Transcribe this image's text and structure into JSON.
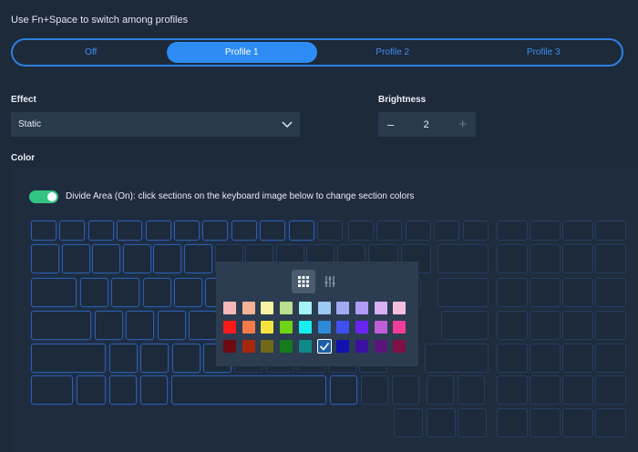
{
  "hint": "Use Fn+Space to switch among profiles",
  "profiles": {
    "tabs": [
      "Off",
      "Profile 1",
      "Profile 2",
      "Profile 3"
    ],
    "active": "Profile 1"
  },
  "effect": {
    "label": "Effect",
    "value": "Static",
    "icon": "chevron-down-icon"
  },
  "brightness": {
    "label": "Brightness",
    "value": "2",
    "minus": "–",
    "plus": "+"
  },
  "color": {
    "label": "Color",
    "divide_area": {
      "enabled": true,
      "label": "Divide Area (On): click sections on the keyboard image below to change section colors"
    }
  },
  "color_picker": {
    "icons": [
      "swatch-grid-icon",
      "sliders-icon"
    ],
    "active_icon": "swatch-grid-icon",
    "swatches": [
      [
        "#f6b9b9",
        "#f5b395",
        "#f6f2a3",
        "#b9e08e",
        "#a4f3f5",
        "#9bcaf2",
        "#a3a9f2",
        "#b09cf5",
        "#d7b0f3",
        "#f4bfdf"
      ],
      [
        "#ff1a1a",
        "#f47a4a",
        "#f4e33f",
        "#6fd414",
        "#14eef0",
        "#2d8ad8",
        "#3f4ff0",
        "#6a24f0",
        "#c05ed8",
        "#f03d9a"
      ],
      [
        "#6d0a12",
        "#a5280e",
        "#716918",
        "#157b1d",
        "#0e8b86",
        "#1c5fa8",
        "#1111b0",
        "#3a10a0",
        "#5a157c",
        "#7e1045"
      ]
    ],
    "selected": {
      "row": 2,
      "col": 5
    }
  }
}
